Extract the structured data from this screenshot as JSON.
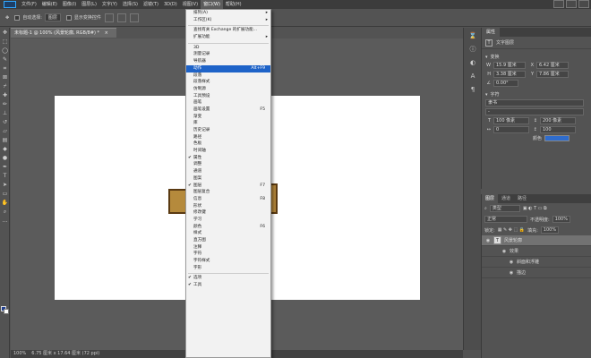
{
  "menubar": {
    "items": [
      "文件(F)",
      "编辑(E)",
      "图像(I)",
      "图层(L)",
      "文字(Y)",
      "选择(S)",
      "滤镜(T)",
      "3D(D)",
      "视图(V)",
      "窗口(W)",
      "帮助(H)"
    ],
    "active_index": 9
  },
  "optionsbar": {
    "auto_select_label": "自动选择:",
    "auto_select_value": "图层",
    "show_transform_label": "显示变换控件"
  },
  "document": {
    "tab_title": "未标题-1 @ 100% (风景轮廓, RGB/8#) *",
    "close": "×"
  },
  "window_menu": {
    "items": [
      {
        "label": "排列(A)",
        "submenu": true
      },
      {
        "label": "工作区(K)",
        "submenu": true
      },
      {
        "sep": true
      },
      {
        "label": "查找有关 Exchange 的扩展功能..."
      },
      {
        "label": "扩展功能",
        "submenu": true
      },
      {
        "sep": true
      },
      {
        "label": "3D"
      },
      {
        "label": "测量记录"
      },
      {
        "label": "导航器"
      },
      {
        "label": "动作",
        "shortcut": "Alt+F9",
        "highlight": true
      },
      {
        "label": "段落"
      },
      {
        "label": "段落样式"
      },
      {
        "label": "仿制源"
      },
      {
        "label": "工具预设"
      },
      {
        "label": "画笔"
      },
      {
        "label": "画笔设置",
        "shortcut": "F5"
      },
      {
        "label": "渐变"
      },
      {
        "label": "库"
      },
      {
        "label": "历史记录"
      },
      {
        "label": "路径"
      },
      {
        "label": "色板"
      },
      {
        "label": "时间轴"
      },
      {
        "label": "属性",
        "checked": true
      },
      {
        "label": "调整"
      },
      {
        "label": "通道"
      },
      {
        "label": "图案"
      },
      {
        "label": "图层",
        "shortcut": "F7",
        "checked": true
      },
      {
        "label": "图层复合"
      },
      {
        "label": "信息",
        "shortcut": "F8"
      },
      {
        "label": "形状"
      },
      {
        "label": "修改键"
      },
      {
        "label": "学习"
      },
      {
        "label": "颜色",
        "shortcut": "F6"
      },
      {
        "label": "样式"
      },
      {
        "label": "直方图"
      },
      {
        "label": "注释"
      },
      {
        "label": "字符"
      },
      {
        "label": "字符样式"
      },
      {
        "label": "字形"
      },
      {
        "sep": true
      },
      {
        "label": "选项",
        "checked": true
      },
      {
        "label": "工具",
        "checked": true
      }
    ]
  },
  "properties": {
    "tab": "属性",
    "type_label": "文字图层",
    "transform_label": "变换",
    "w_label": "W",
    "w_value": "15.9 厘米",
    "x_label": "X",
    "x_value": "6.42 厘米",
    "h_label": "H",
    "h_value": "3.38 厘米",
    "y_label": "Y",
    "y_value": "7.86 厘米",
    "angle_value": "0.00°",
    "char_label": "字符",
    "font_family": "隶书",
    "font_style": "-",
    "size_value": "100 像素",
    "leading_value": "200 像素",
    "tracking_value": "0",
    "scale_value": "100",
    "color_label": "颜色",
    "color_hex": "#2f6ccc"
  },
  "layers": {
    "tabs": [
      "图层",
      "通道",
      "路径"
    ],
    "kind": "类型",
    "blend": "正常",
    "opacity_label": "不透明度:",
    "opacity_value": "100%",
    "lock_label": "锁定:",
    "fill_label": "填充:",
    "fill_value": "100%",
    "items": [
      {
        "name": "风景轮廓",
        "selected": true
      },
      {
        "name": "效果",
        "indent": 1
      },
      {
        "name": "斜面和浮雕",
        "indent": 2
      },
      {
        "name": "描边",
        "indent": 2
      }
    ]
  },
  "status": {
    "zoom": "100%",
    "doc_size": "6.75 厘米 x 17.64 厘米 (72 ppi)"
  },
  "colors": {
    "foreground": "#1f3f91",
    "background": "#ffffff",
    "highlight": "#1e63c8"
  }
}
